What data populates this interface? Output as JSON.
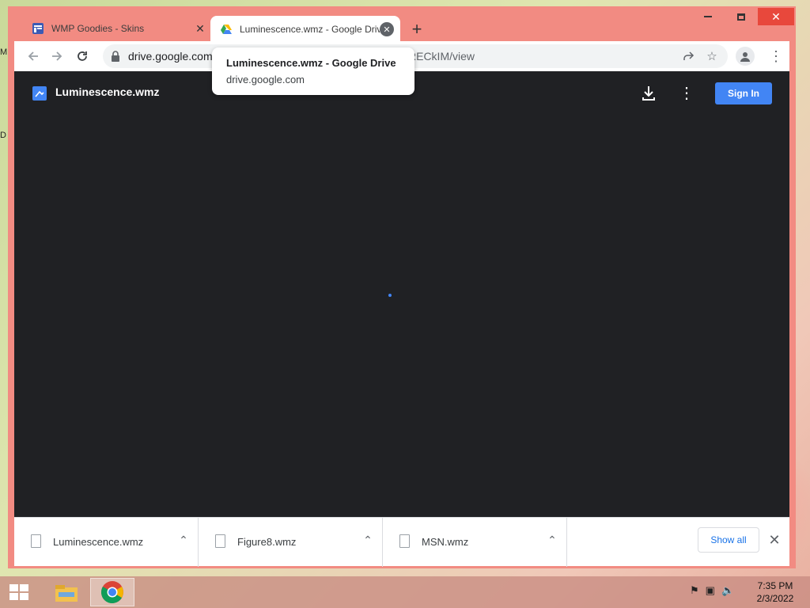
{
  "tabs": [
    {
      "title": "WMP Goodies - Skins",
      "favicon": "wmp-goodies-favicon",
      "active": false
    },
    {
      "title": "Luminescence.wmz - Google Drive",
      "favicon": "google-drive-icon",
      "active": true
    }
  ],
  "window_controls": {
    "minimize": "minimize",
    "maximize": "maximize",
    "close": "close"
  },
  "address_bar": {
    "url_prefix": "drive.google.com",
    "url_suffix": "RECkIM/view",
    "lock_icon": "lock-icon"
  },
  "tooltip": {
    "title": "Luminescence.wmz - Google Drive",
    "url": "drive.google.com"
  },
  "viewer": {
    "file_name": "Luminescence.wmz",
    "sign_in_label": "Sign In",
    "accent_color": "#4285f4",
    "background_color": "#202124"
  },
  "downloads": {
    "items": [
      {
        "name": "Luminescence.wmz"
      },
      {
        "name": "Figure8.wmz"
      },
      {
        "name": "MSN.wmz"
      }
    ],
    "show_all_label": "Show all"
  },
  "taskbar": {
    "time": "7:35 PM",
    "date": "2/3/2022"
  },
  "desktop_edge": {
    "top_letter": "M",
    "mid_letter": "D"
  }
}
